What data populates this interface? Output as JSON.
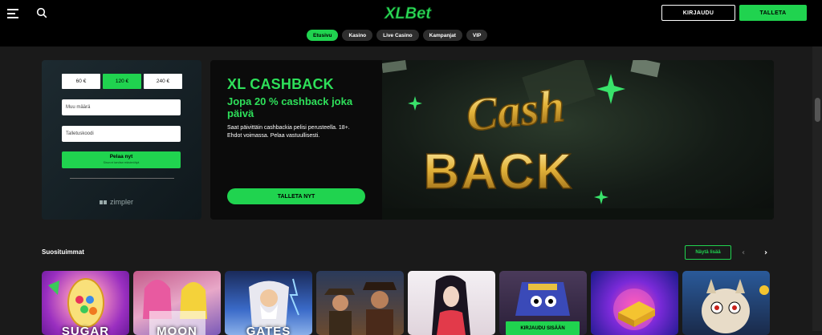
{
  "header": {
    "logo_text": "XLBet",
    "login_label": "KIRJAUDU",
    "deposit_label": "TALLETA",
    "tabs": [
      {
        "label": "Etusivu",
        "active": true
      },
      {
        "label": "Kasino",
        "active": false
      },
      {
        "label": "Live Casino",
        "active": false
      },
      {
        "label": "Kampanjat",
        "active": false
      },
      {
        "label": "VIP",
        "active": false
      }
    ]
  },
  "deposit": {
    "amounts": [
      "60 €",
      "120 €",
      "240 €"
    ],
    "selected_amount": "120 €",
    "other_amount_placeholder": "Muu määrä",
    "bonus_code_placeholder": "Talletuskoodi",
    "play_label": "Pelaa nyt",
    "play_sublabel": "Sinun ei tarvitse rekisteröityä",
    "provider": "zimpler"
  },
  "banner": {
    "title": "XL CASHBACK",
    "subtitle": "Jopa 20 % cashback joka päivä",
    "text": "Saat päivittäin cashbackia pelisi perusteella. 18+. Ehdot voimassa. Pelaa vastuullisesti.",
    "button_label": "TALLETA NYT",
    "art_word_1": "Cash",
    "art_word_2": "BACK"
  },
  "popular": {
    "title": "Suosituimmat",
    "show_more_label": "Näytä lisää",
    "games": [
      {
        "name": "SUGAR",
        "bg": "#b23fc8"
      },
      {
        "name": "MOON",
        "bg": "#d68ab0"
      },
      {
        "name": "GATES",
        "bg": "#3a5a9a"
      },
      {
        "name": "",
        "bg": "#5a4030"
      },
      {
        "name": "",
        "bg": "#e8e0e4"
      },
      {
        "name": "",
        "bg": "#3a2a4a",
        "login_label": "KIRJAUDU SISÄÄN"
      },
      {
        "name": "",
        "bg": "#2a1aa0"
      },
      {
        "name": "",
        "bg": "#1a3a6a"
      }
    ]
  },
  "colors": {
    "accent": "#20d34f",
    "background": "#1a1a1a",
    "topbar": "#000000"
  }
}
